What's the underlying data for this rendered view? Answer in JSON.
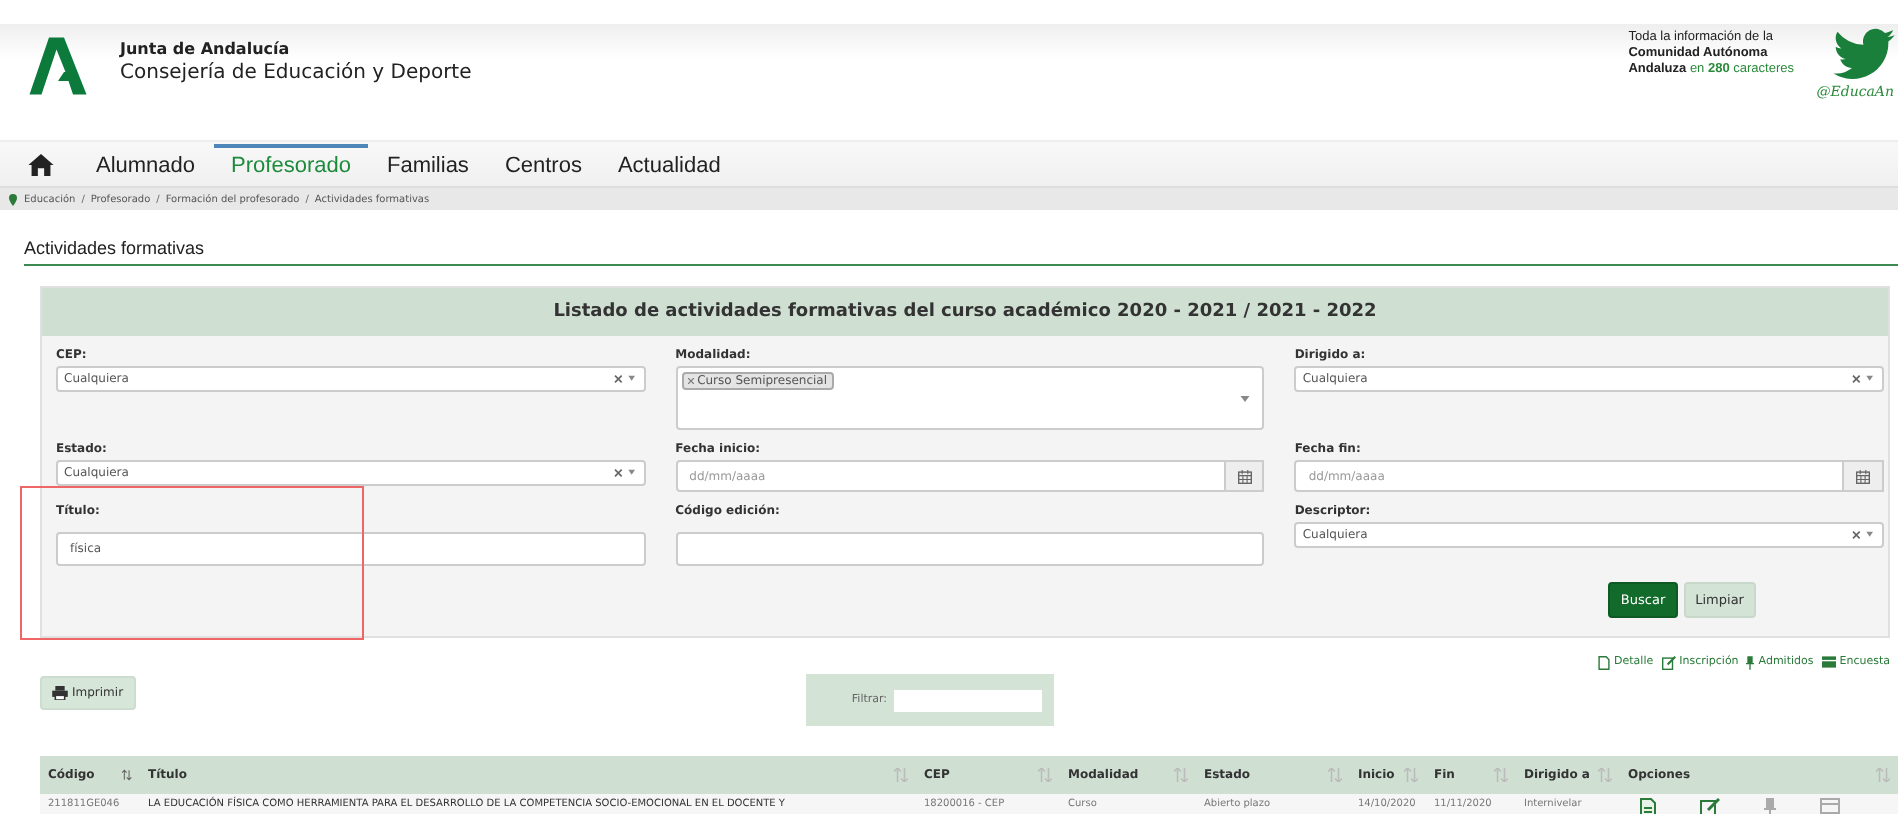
{
  "header": {
    "org": "Junta de Andalucía",
    "department": "Consejería de Educación y Deporte",
    "promo": [
      "Toda la información de la",
      "**Comunidad Autónoma**",
      "**Andaluza** en **280** caracteres"
    ],
    "handle": "@EducaAn"
  },
  "nav": [
    {
      "label": "Alumnado",
      "selected": false
    },
    {
      "label": "Profesorado",
      "selected": true
    },
    {
      "label": "Familias",
      "selected": false
    },
    {
      "label": "Centros",
      "selected": false
    },
    {
      "label": "Actualidad",
      "selected": false
    }
  ],
  "breadcrumb": {
    "separator": "/",
    "items": [
      "Educación",
      "Profesorado",
      "Formación del profesorado",
      "Actividades formativas"
    ]
  },
  "page_title": "Actividades formativas",
  "filter_panel": {
    "title": "Listado de actividades formativas del curso académico 2020 - 2021 / 2021 - 2022",
    "fields": [
      {
        "kind": "select",
        "label": "CEP:",
        "value": "Cualquiera"
      },
      {
        "kind": "multiselect",
        "label": "Modalidad:",
        "tags": [
          "Curso Semipresencial"
        ]
      },
      {
        "kind": "select",
        "label": "Dirigido a:",
        "value": "Cualquiera"
      },
      {
        "kind": "select",
        "label": "Estado:",
        "value": "Cualquiera"
      },
      {
        "kind": "date",
        "label": "Fecha inicio:",
        "placeholder": "dd/mm/aaaa"
      },
      {
        "kind": "date",
        "label": "Fecha fin:",
        "placeholder": "dd/mm/aaaa"
      },
      {
        "kind": "text",
        "label": "Título:",
        "value": "física",
        "highlighted": true
      },
      {
        "kind": "text",
        "label": "Código edición:"
      },
      {
        "kind": "select",
        "label": "Descriptor:",
        "value": "Cualquiera"
      }
    ],
    "buttons": [
      {
        "label": "Buscar",
        "kind": "primary"
      },
      {
        "label": "Limpiar",
        "kind": "secondary"
      }
    ]
  },
  "legend": [
    {
      "label": "Detalle"
    },
    {
      "label": "Inscripción"
    },
    {
      "label": "Admitidos"
    },
    {
      "label": "Encuesta"
    }
  ],
  "print_button": "Imprimir",
  "filter": {
    "label": "Filtrar:"
  },
  "table": {
    "columns": [
      {
        "label": "Código",
        "sorted": true
      },
      {
        "label": "Título",
        "sorted": false
      },
      {
        "label": "CEP",
        "sorted": false
      },
      {
        "label": "Modalidad",
        "sorted": false
      },
      {
        "label": "Estado",
        "sorted": false
      },
      {
        "label": "Inicio",
        "sorted": false
      },
      {
        "label": "Fin",
        "sorted": false
      },
      {
        "label": "Dirigido a",
        "sorted": false
      },
      {
        "label": "Opciones",
        "sorted": false
      }
    ],
    "rows": [
      {
        "cells": [
          "211811GE046",
          "LA EDUCACIÓN FÍSICA COMO HERRAMIENTA PARA EL DESARROLLO DE LA COMPETENCIA SOCIO-EMOCIONAL EN EL DOCENTE Y",
          "18200016 - CEP",
          "Curso",
          "Abierto plazo",
          "14/10/2020",
          "11/11/2020",
          "Internivelar"
        ]
      }
    ]
  }
}
